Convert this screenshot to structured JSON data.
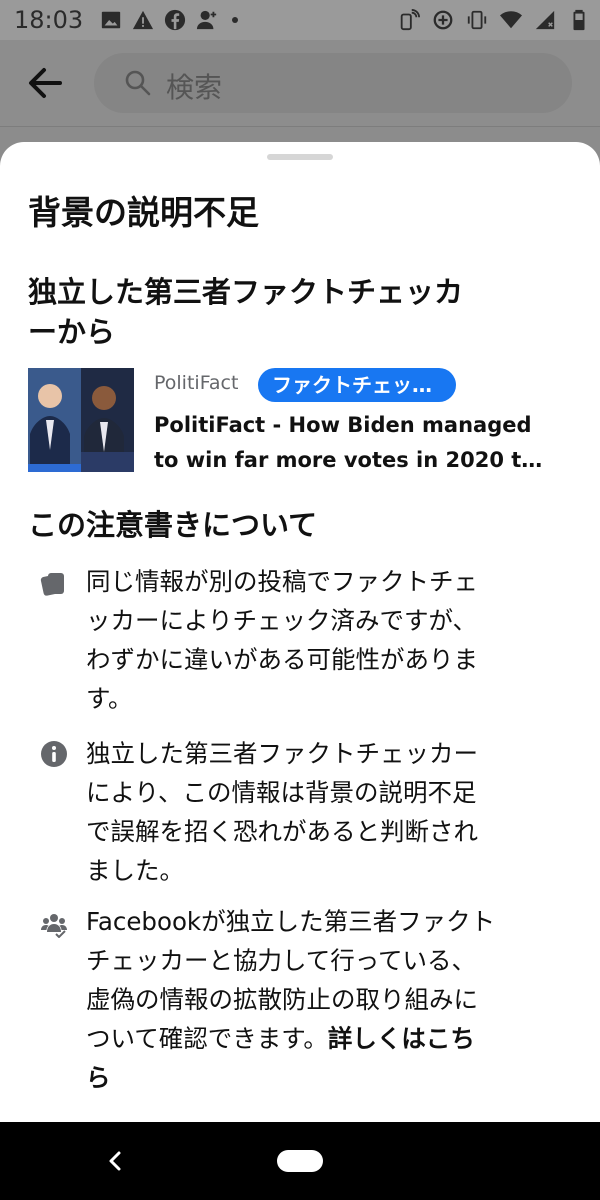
{
  "status_bar": {
    "time": "18:03"
  },
  "search": {
    "placeholder": "検索"
  },
  "sheet": {
    "title": "背景の説明不足",
    "fact_checker_heading_lines": [
      "独立した第三者ファクトチェッカ",
      "ーから"
    ],
    "article": {
      "publisher": "PolitiFact",
      "badge": "ファクトチェッ…",
      "title_lines": [
        "PolitiFact - How Biden managed",
        "to win far more votes in 2020 t…"
      ]
    },
    "about_heading": "この注意書きについて",
    "info_items": [
      {
        "icon": "cards-icon",
        "lines": [
          "同じ情報が別の投稿でファクトチェ",
          "ッカーによりチェック済みですが、",
          "わずかに違いがある可能性がありま",
          "す。"
        ]
      },
      {
        "icon": "info-icon",
        "lines": [
          "独立した第三者ファクトチェッカー",
          "により、この情報は背景の説明不足",
          "で誤解を招く恐れがあると判断され",
          "ました。"
        ]
      },
      {
        "icon": "people-icon",
        "lines": [
          "Facebookが独立した第三者ファクト",
          "チェッカーと協力して行っている、",
          "虚偽の情報の拡散防止の取り組みに",
          "ついて確認できます。"
        ],
        "learn_more": "詳しくはこち",
        "learn_more_tail": "ら"
      }
    ]
  },
  "colors": {
    "accent": "#1877f2",
    "scrim": "#8c8c8c",
    "icon_gray": "#65676b"
  }
}
